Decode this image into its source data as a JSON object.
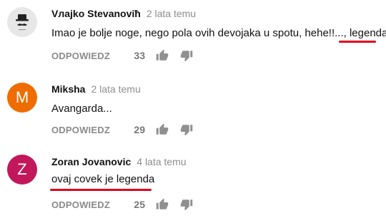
{
  "comments": [
    {
      "author": "Vлajko Stevanoviħ",
      "time": "2 lata temu",
      "text": "Imao je bolje noge, nego pola ovih devojaka u spotu, hehe!!..., legenda.",
      "reply_label": "ODPOWIEDZ",
      "likes": "33",
      "avatar_letter": "",
      "avatar_color": "#e7e7e7"
    },
    {
      "author": "Miksha",
      "time": "2 lata temu",
      "text": "Avangarda...",
      "reply_label": "ODPOWIEDZ",
      "likes": "29",
      "avatar_letter": "M",
      "avatar_color": "#ef6c00"
    },
    {
      "author": "Zoran Jovanovic",
      "time": "4 lata temu",
      "text": "ovaj covek je legenda",
      "reply_label": "ODPOWIEDZ",
      "likes": "25",
      "avatar_letter": "Z",
      "avatar_color": "#c2185b"
    }
  ],
  "icons": {
    "like": "thumbs-up-icon",
    "dislike": "thumbs-down-icon",
    "avatar_photo": "hat-and-mustache-icon"
  },
  "colors": {
    "underline": "#e3001b",
    "meta_text": "#8d8d8d"
  }
}
